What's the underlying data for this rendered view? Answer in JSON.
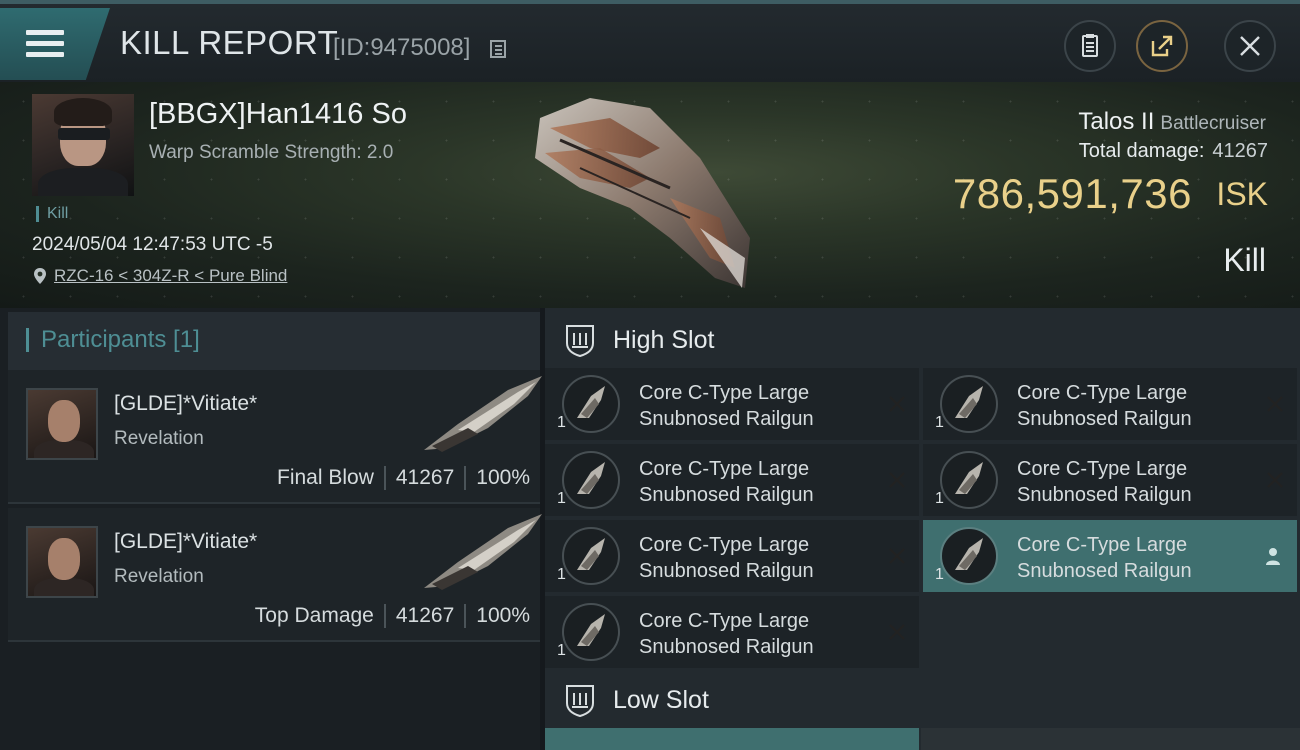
{
  "header": {
    "title": "KILL REPORT",
    "report_id": "[ID:9475008]"
  },
  "victim": {
    "name": "[BBGX]Han1416 So",
    "warp_scramble": "Warp Scramble Strength: 2.0",
    "tag": "Kill",
    "datetime": "2024/05/04 12:47:53 UTC -5",
    "location": "RZC-16 < 304Z-R < Pure Blind",
    "ship_name": "Talos II",
    "ship_class": "Battlecruiser",
    "total_damage_label": "Total damage:",
    "total_damage": "41267",
    "isk_value": "786,591,736",
    "isk_unit": "ISK",
    "result": "Kill"
  },
  "participants": {
    "header": "Participants [1]",
    "rows": [
      {
        "name": "[GLDE]*Vitiate*",
        "ship": "Revelation",
        "role": "Final Blow",
        "damage": "41267",
        "percent": "100%"
      },
      {
        "name": "[GLDE]*Vitiate*",
        "ship": "Revelation",
        "role": "Top Damage",
        "damage": "41267",
        "percent": "100%"
      }
    ]
  },
  "slots": {
    "high_label": "High Slot",
    "low_label": "Low Slot",
    "high_modules": [
      {
        "line1": "Core C-Type Large",
        "line2": "Snubnosed Railgun",
        "qty": "1",
        "status": "destroyed"
      },
      {
        "line1": "Core C-Type Large",
        "line2": "Snubnosed Railgun",
        "qty": "1",
        "status": "destroyed"
      },
      {
        "line1": "Core C-Type Large",
        "line2": "Snubnosed Railgun",
        "qty": "1",
        "status": "destroyed"
      },
      {
        "line1": "Core C-Type Large",
        "line2": "Snubnosed Railgun",
        "qty": "1",
        "status": "destroyed"
      },
      {
        "line1": "Core C-Type Large",
        "line2": "Snubnosed Railgun",
        "qty": "1",
        "status": "destroyed"
      },
      {
        "line1": "Core C-Type Large",
        "line2": "Snubnosed Railgun",
        "qty": "1",
        "status": "dropped"
      },
      {
        "line1": "Core C-Type Large",
        "line2": "Snubnosed Railgun",
        "qty": "1",
        "status": "destroyed"
      }
    ]
  },
  "colors": {
    "accent": "#4e8e94",
    "isk": "#e9d08a",
    "dropped_row": "#3f6f6f"
  },
  "icons": [
    "menu-icon",
    "copy-icon",
    "report-icon",
    "share-icon",
    "close-icon",
    "location-pin-icon",
    "high-slot-icon",
    "low-slot-icon",
    "railgun-icon",
    "destroyed-x-icon",
    "person-icon"
  ]
}
